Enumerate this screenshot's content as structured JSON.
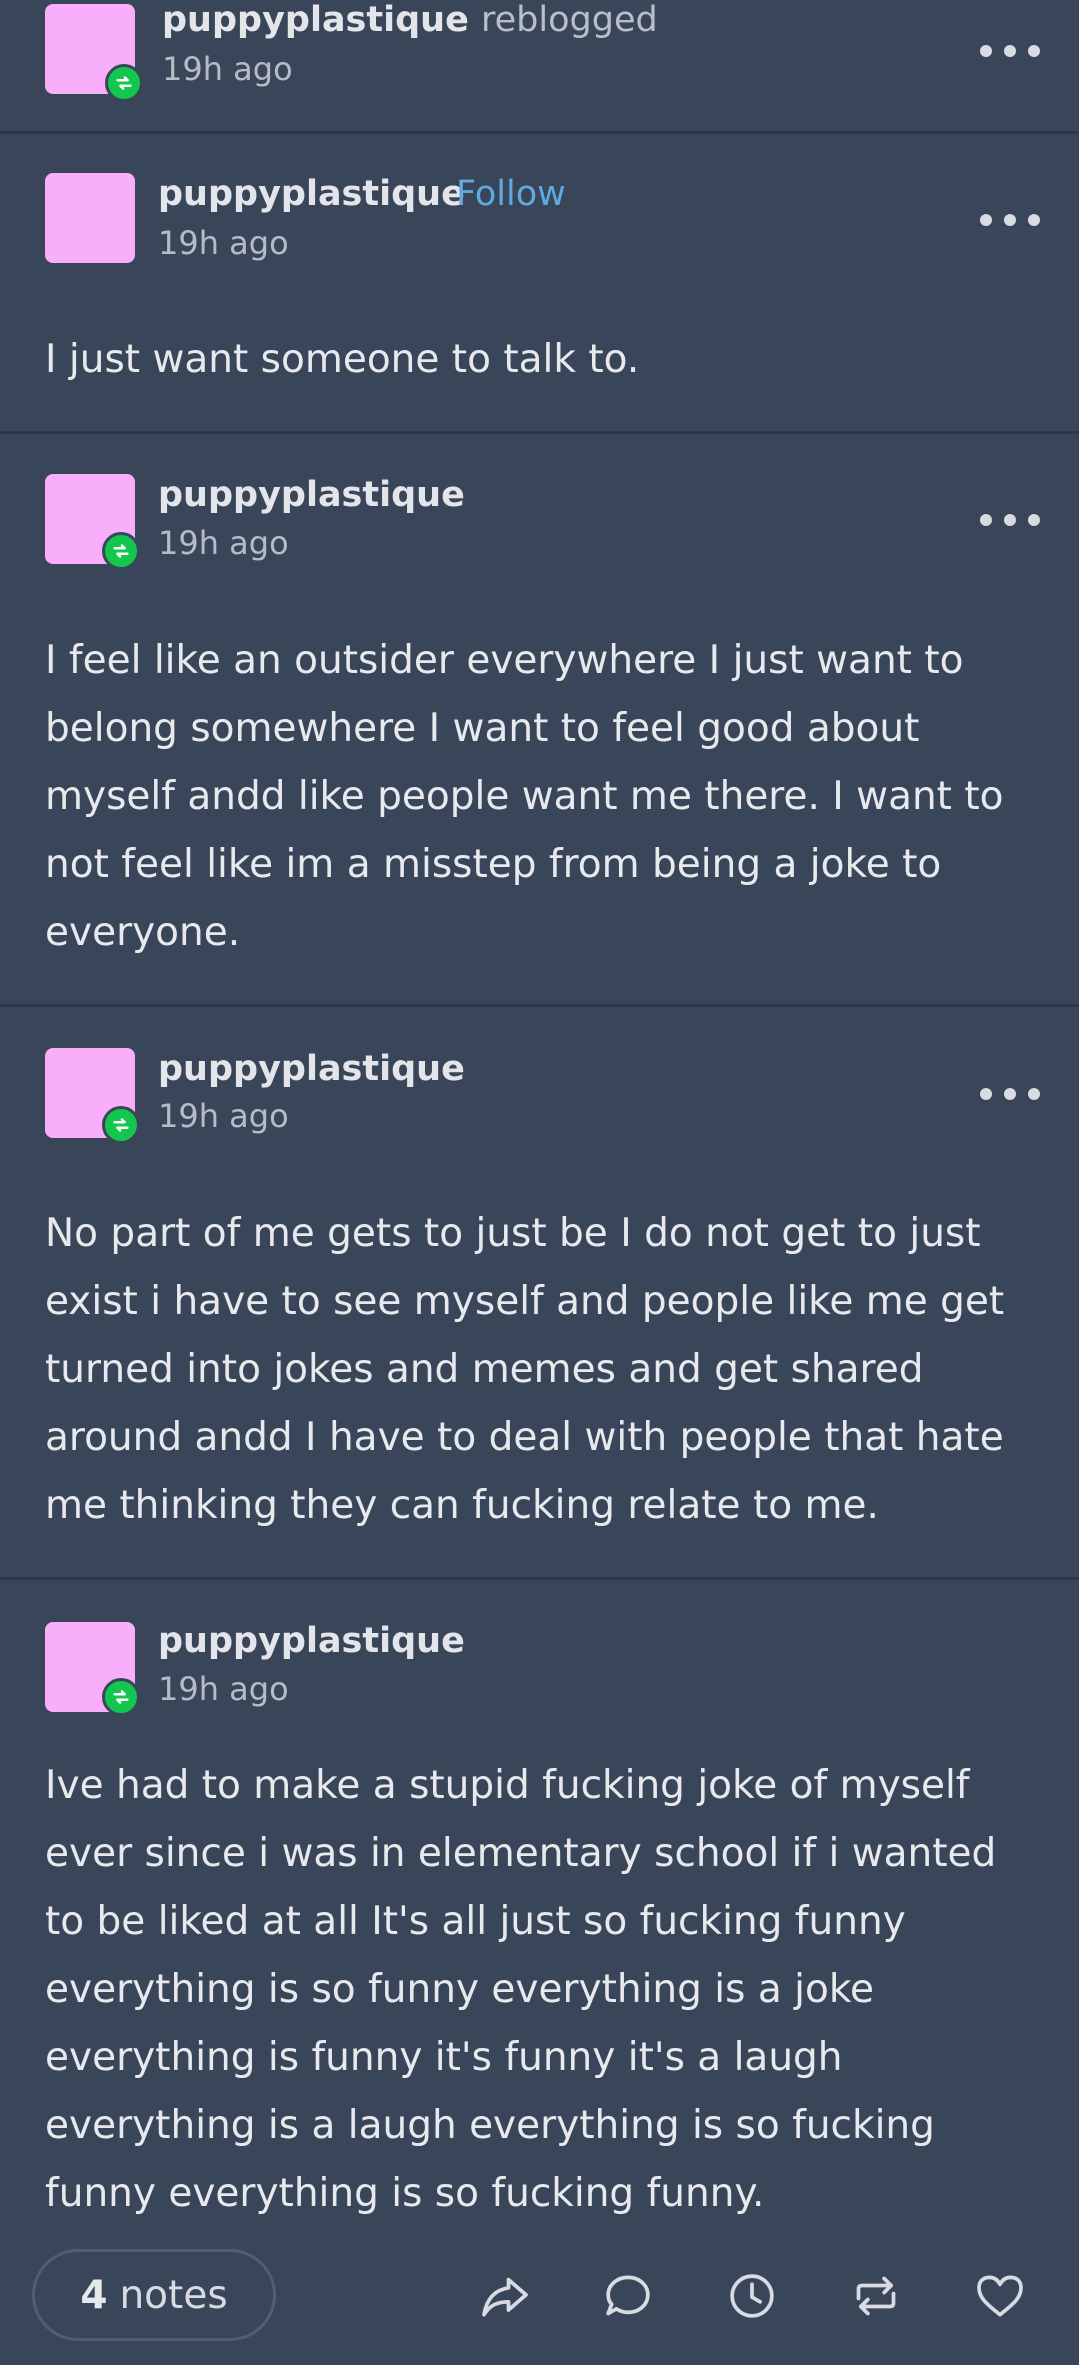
{
  "colors": {
    "background": "#39465a",
    "divider": "#2c3748",
    "avatar": "#f9aef9",
    "reblog_badge": "#13c64d",
    "follow_link": "#5fa9e0"
  },
  "top_reblog": {
    "username": "puppyplastique",
    "action": "reblogged",
    "time": "19h ago"
  },
  "posts": [
    {
      "username": "puppyplastique",
      "follow_label": "Follow",
      "time": "19h ago",
      "text": "I just want someone to talk to."
    },
    {
      "username": "puppyplastique",
      "time": "19h ago",
      "text": "I feel like an outsider everywhere I just want to belong somewhere I want to feel good about myself andd like people want me there. I want to not feel like im a misstep from being a joke to everyone."
    },
    {
      "username": "puppyplastique",
      "time": "19h ago",
      "text": "No part of me gets to just be I do not get to just exist i have to see myself and people like me get turned into jokes and memes and get shared around andd I have to deal with people that hate me thinking they can fucking relate to me."
    },
    {
      "username": "puppyplastique",
      "time": "19h ago",
      "text": "Ive had to make a stupid fucking joke of myself ever since i was in elementary school if i wanted to be liked at all It's all just so fucking funny everything is so funny everything is a joke everything is funny it's funny it's a laugh everything is a laugh everything is so fucking funny everything is so fucking funny."
    }
  ],
  "footer": {
    "notes_count": "4",
    "notes_label": "notes",
    "icons": [
      "share-icon",
      "reply-icon",
      "history-icon",
      "reblog-icon",
      "like-icon"
    ]
  }
}
